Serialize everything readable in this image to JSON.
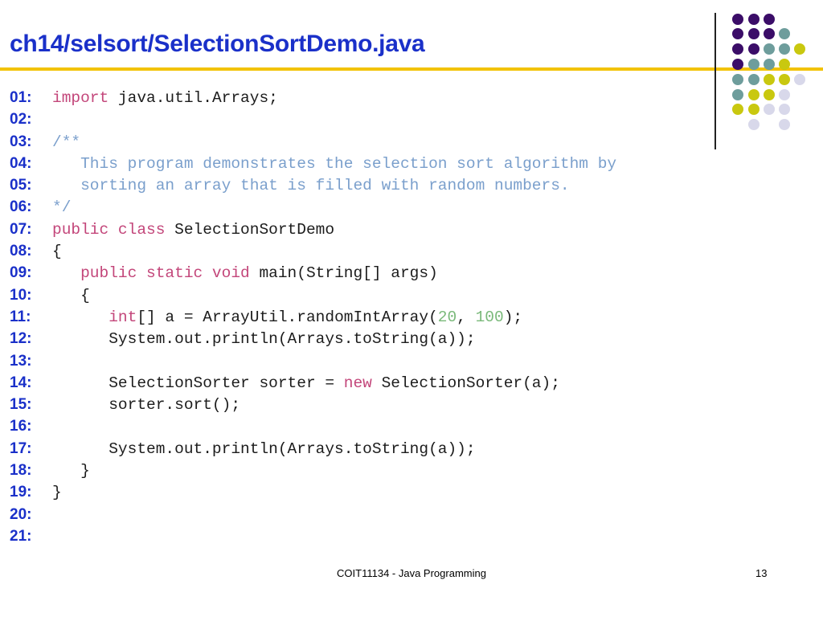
{
  "slide": {
    "title": "ch14/selsort/SelectionSortDemo.java",
    "footer_text": "COIT11134 - Java Programming",
    "page_number": "13"
  },
  "palette": {
    "title_color": "#1a30c9",
    "rule_color": "#f2c200",
    "dot_colors": [
      "#3b0d68",
      "#6e9d9c",
      "#c9c80f",
      "#d8d8ea"
    ]
  },
  "code": {
    "lines": [
      {
        "number": "01:",
        "tokens": [
          {
            "text": "import",
            "kind": "kw"
          },
          {
            "text": " java.util.Arrays;",
            "kind": "pl"
          }
        ]
      },
      {
        "number": "02:",
        "tokens": []
      },
      {
        "number": "03:",
        "tokens": [
          {
            "text": "/**",
            "kind": "cm"
          }
        ]
      },
      {
        "number": "04:",
        "tokens": [
          {
            "text": "   This program demonstrates the selection sort algorithm by",
            "kind": "cm"
          }
        ]
      },
      {
        "number": "05:",
        "tokens": [
          {
            "text": "   sorting an array that is filled with random numbers.",
            "kind": "cm"
          }
        ]
      },
      {
        "number": "06:",
        "tokens": [
          {
            "text": "*/",
            "kind": "cm"
          }
        ]
      },
      {
        "number": "07:",
        "tokens": [
          {
            "text": "public class",
            "kind": "kw"
          },
          {
            "text": " SelectionSortDemo",
            "kind": "pl"
          }
        ]
      },
      {
        "number": "08:",
        "tokens": [
          {
            "text": "{",
            "kind": "pl"
          }
        ]
      },
      {
        "number": "09:",
        "tokens": [
          {
            "text": "   ",
            "kind": "pl"
          },
          {
            "text": "public static void",
            "kind": "kw"
          },
          {
            "text": " main(String[] args)",
            "kind": "pl"
          }
        ]
      },
      {
        "number": "10:",
        "tokens": [
          {
            "text": "   {",
            "kind": "pl"
          }
        ]
      },
      {
        "number": "11:",
        "tokens": [
          {
            "text": "      ",
            "kind": "pl"
          },
          {
            "text": "int",
            "kind": "kw"
          },
          {
            "text": "[] a = ArrayUtil.randomIntArray(",
            "kind": "pl"
          },
          {
            "text": "20",
            "kind": "num"
          },
          {
            "text": ", ",
            "kind": "pl"
          },
          {
            "text": "100",
            "kind": "num"
          },
          {
            "text": ");",
            "kind": "pl"
          }
        ]
      },
      {
        "number": "12:",
        "tokens": [
          {
            "text": "      System.out.println(Arrays.toString(a));",
            "kind": "pl"
          }
        ]
      },
      {
        "number": "13:",
        "tokens": []
      },
      {
        "number": "14:",
        "tokens": [
          {
            "text": "      SelectionSorter sorter = ",
            "kind": "pl"
          },
          {
            "text": "new",
            "kind": "kw"
          },
          {
            "text": " SelectionSorter(a);",
            "kind": "pl"
          }
        ]
      },
      {
        "number": "15:",
        "tokens": [
          {
            "text": "      sorter.sort();",
            "kind": "pl"
          }
        ]
      },
      {
        "number": "16:",
        "tokens": []
      },
      {
        "number": "17:",
        "tokens": [
          {
            "text": "      System.out.println(Arrays.toString(a));",
            "kind": "pl"
          }
        ]
      },
      {
        "number": "18:",
        "tokens": [
          {
            "text": "   }",
            "kind": "pl"
          }
        ]
      },
      {
        "number": "19:",
        "tokens": [
          {
            "text": "}",
            "kind": "pl"
          }
        ]
      },
      {
        "number": "20:",
        "tokens": []
      },
      {
        "number": "21:",
        "tokens": []
      }
    ]
  }
}
